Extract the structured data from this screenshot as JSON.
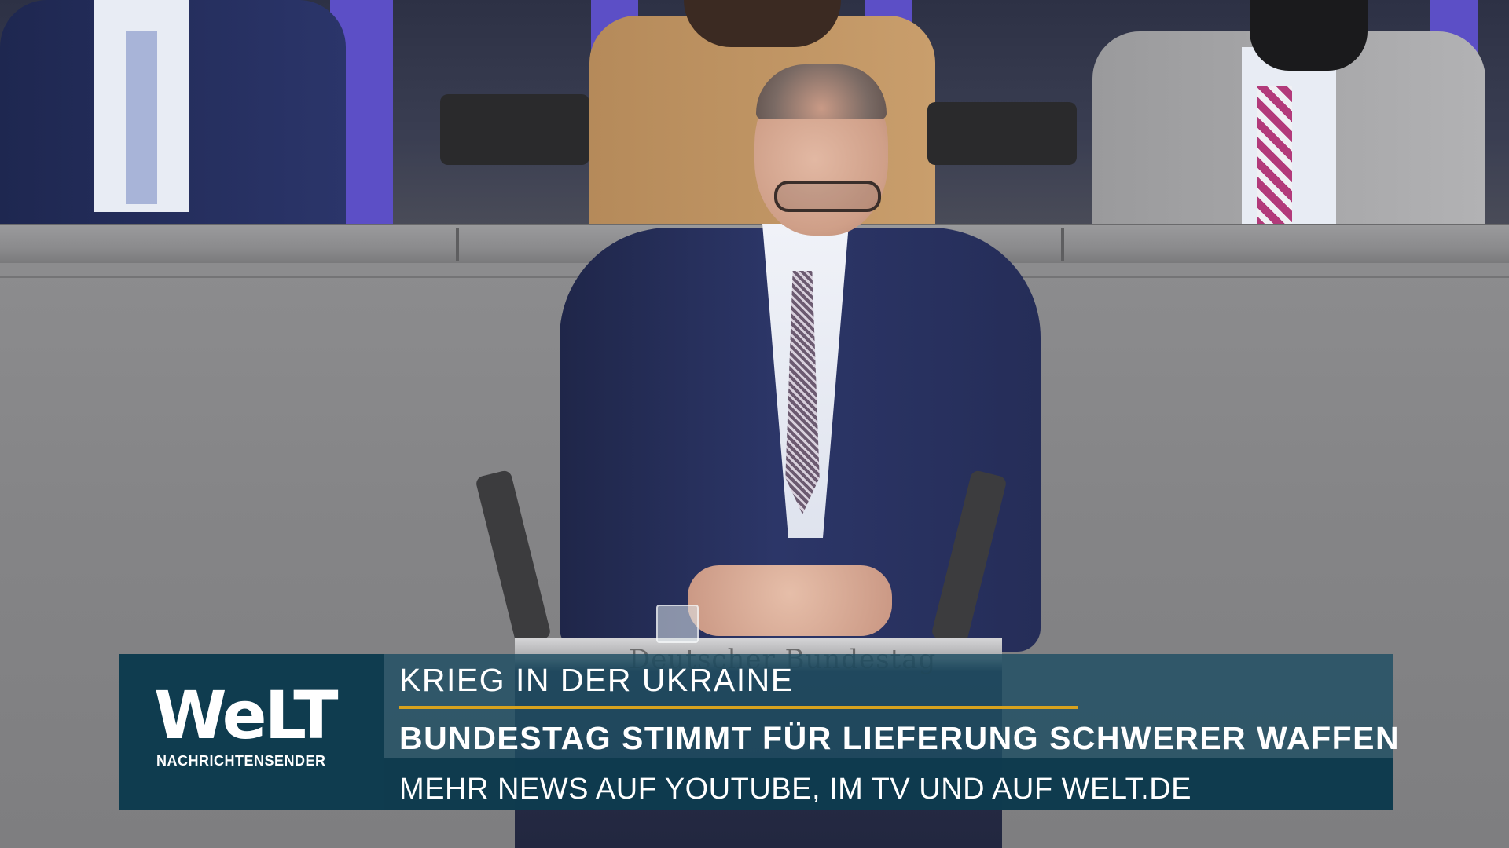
{
  "broadcast": {
    "logo_text": "WeLT",
    "logo_subtitle": "NACHRICHTENSENDER",
    "kicker": "KRIEG IN DER UKRAINE",
    "headline": "BUNDESTAG STIMMT FÜR LIEFERUNG SCHWERER WAFFEN",
    "ticker": "MEHR NEWS AUF YOUTUBE, IM TV UND AUF WELT.DE"
  },
  "scene": {
    "lectern_label": "Deutscher Bundestag"
  },
  "colors": {
    "logo_bg": "#0f3c4f",
    "text_panel_bg": "#1f4e63",
    "accent": "#d8a21d",
    "seat": "#5c4fc6"
  }
}
